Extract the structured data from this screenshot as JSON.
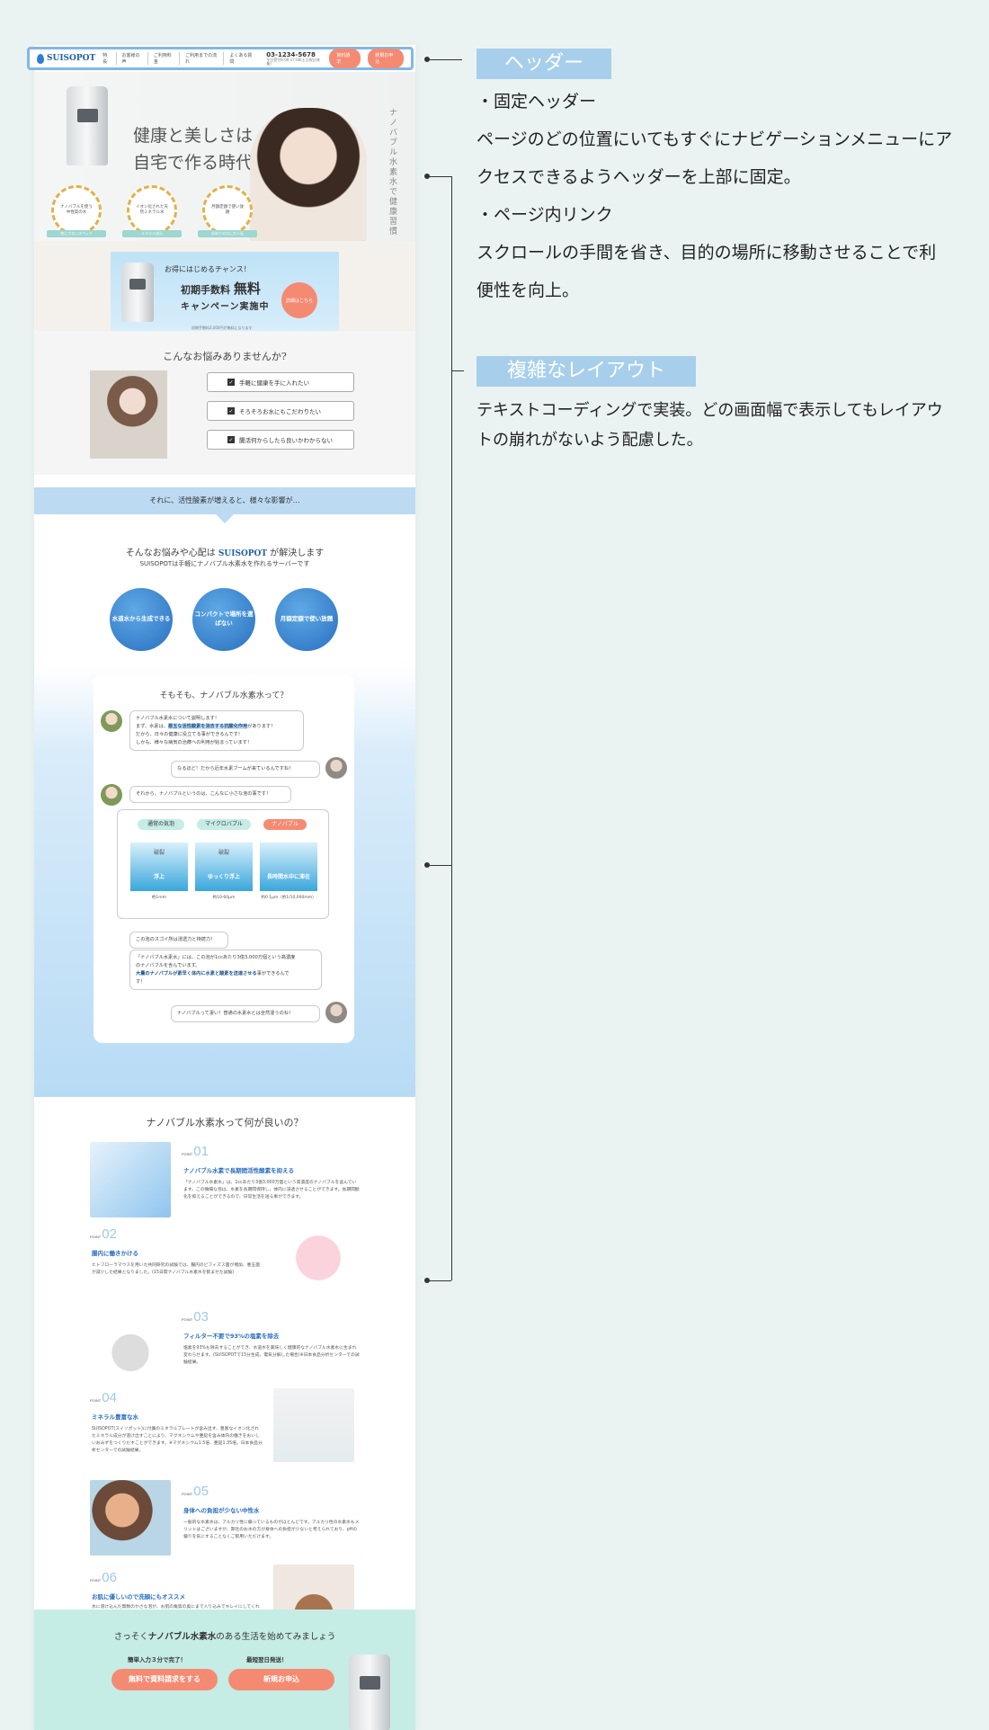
{
  "header": {
    "logo": "SUISOPOT",
    "nav": [
      "特長",
      "お客様の声",
      "ご利用料金",
      "ご利用までの流れ",
      "よくある質問"
    ],
    "tel": "03-1234-5678",
    "tel_note": "平日受付9:00-17:00(土日祝日休業)",
    "btn_docs": "資料請求",
    "btn_apply": "新規お申込"
  },
  "hero": {
    "title_line1": "健康と美しさは",
    "title_line2": "自宅で作る時代",
    "vertical": "ナノバブル水素水で健康習慣",
    "badges": [
      {
        "text": "ナノバブルを使う中性質の水",
        "ribbon": "他にさないスペック"
      },
      {
        "text": "イオン化された天然ミネラル水",
        "ribbon": "ミネラル成分"
      },
      {
        "text": "月額定額で使い放題",
        "ribbon": "初めての方に大人気"
      }
    ]
  },
  "campaign": {
    "lead": "お得にはじめるチャンス！",
    "line2_a": "初期手数料",
    "line2_b": "無料",
    "line3": "キャンペーン実施中",
    "button": "詳細はこちら",
    "note": "初期手数料3,000円が無料になります"
  },
  "worries": {
    "title": "こんなお悩みありませんか?",
    "items": [
      "手軽に健康を手に入れたい",
      "そろそろお水にもこだわりたい",
      "腸活何からしたら良いかわからない"
    ],
    "band": "それに、活性酸素が増えると、様々な影響が…"
  },
  "solve": {
    "line1_a": "そんなお悩みや心配は",
    "line1_logo": "SUISOPOT",
    "line1_b": "が解決します",
    "line2": "SUISOPOTは手軽にナノバブル水素水を作れるサーバーです",
    "circles": [
      "水道水から生成できる",
      "コンパクトで場所を選ばない",
      "月額定額で使い放題"
    ]
  },
  "nano": {
    "title": "そもそも、ナノバブル水素水って？",
    "b1_l1": "ナノバブル水素水について説明します！",
    "b1_l2a": "まず、水素は、",
    "b1_l2b": "悪玉な活性酸素を消去する抗酸化作用",
    "b1_l2c": "があります！",
    "b1_l3": "だから、日々の健康に役立てる事ができるんです！",
    "b1_l4": "しかも、様々な病気の治療への利用が始まっています！",
    "b2": "なるほど！だから近年水素ブームが来ているんですね！",
    "b3": "それから、ナノバブルというのは、こんなに小さな泡の事です！",
    "pills": [
      "通常の気泡",
      "マイクロバブル",
      "ナノバブル"
    ],
    "tiles_top": [
      "破裂",
      "破裂",
      ""
    ],
    "tiles_bot": [
      "浮上",
      "ゆっくり浮上",
      "長時間水中に滞在"
    ],
    "sizes": [
      "約1mm",
      "約10-60μm",
      "約0.1μm（約1/10,000mm）"
    ],
    "b4": "この泡のスゴイ所は浸透力と持続力！",
    "b5_l1": "「ナノバブル水素水」には、この泡が1ccあたり3億3,000万個という高濃度",
    "b5_l2": "のナノバブルを含んでいます。",
    "b5_l3a": "大量のナノバブルが素早く体内に水素と酸素を送達させる",
    "b5_l3b": "事ができるんで",
    "b5_l4": "す！",
    "b6": "ナノバブルって凄い！普通の水素水とは全然違うのね！"
  },
  "points": {
    "title": "ナノバブル水素水って何が良いの？",
    "items": [
      {
        "num": "01",
        "head": "ナノバブル水素で長期間活性酸素を抑える",
        "body": "「ナノバブル水素水」は、1ccあたり3億3,000万個という高濃度のナノバブルを含んでいます。この微細な泡は、水素を長期間保持し、体内に浸透させることができます。長期間酸化を抑えることができるので、日常生活を送る事ができます。"
      },
      {
        "num": "02",
        "head": "腸内に働きかける",
        "body": "ヒトフローラマウスを用いた共同研究の試験では、腸内のビフィズス菌が増加、悪玉菌が減少した結果となりました。(15日間ナノバブル水素水を飲ませた試験)"
      },
      {
        "num": "03",
        "head": "フィルター不要で93%の塩素を除去",
        "body": "塩素を93%も除去することができ、水道水を美味しく健康的なナノバブル水素水に生まれ変わらせます。(SUISOPOTで15分生成、電気分解した場合)※日本食品分析センターでの試験結果。"
      },
      {
        "num": "04",
        "head": "ミネラル豊富な水",
        "body": "SUISOPOT(スイソポット)に付属のミネラルプレートが含み出す、豊富なイオン化されたミネラル成分が溶け出すことにより、マグネシウムや亜鉛を含み体内の働きをおいしいおみずをつくりだすことができます。※マグネシウム1.5倍、亜鉛1.35倍。日本食品分析センターでの試験結果。"
      },
      {
        "num": "05",
        "head": "身体への負担が少ない中性水",
        "body": "一般的な水素水は、アルカリ性に偏っているものがほとんどです。アルカリ性の水素水もメリットはございますが、弊社のお水の方が身体への負担が少ないと考えられており、pHの偏りを気にすることなくご飲用いただけます。"
      },
      {
        "num": "06",
        "head": "お肌に優しいので洗顔にもオススメ",
        "body": "水に溶け込んだ無数のかさな泡が、お肌の角質の奥にまで入り込みでキレイにしてくれます。さっと洗い流すだけでさっぱりとした透明肌へと導いてくれます。"
      }
    ],
    "point_label": "POINT"
  },
  "cta": {
    "title_a": "さっそく",
    "title_b": "ナノバブル水素水",
    "title_c": "のある生活を始めてみましょう",
    "sub1": "簡単入力３分で完了！",
    "sub2": "最短翌日発送！",
    "btn1": "無料で資料請求をする",
    "btn2": "新規お申込"
  },
  "annotations": {
    "label1": "ヘッダー",
    "text1_l1": "・固定ヘッダー",
    "text1_l2": "ページのどの位置にいてもすぐにナビゲーションメニューにアクセスできるようヘッダーを上部に固定。",
    "text1_l3": "・ページ内リンク",
    "text1_l4": "スクロールの手間を省き、目的の場所に移動させることで利便性を向上。",
    "label2": "複雑なレイアウト",
    "text2": "テキストコーディングで実装。どの画面幅で表示してもレイアウトの崩れがないよう配慮した。"
  },
  "colors": {
    "accent": "#f58a72",
    "brand": "#1f5fa8",
    "label_bg": "#a7cfeb",
    "background": "#eaf3f2"
  }
}
